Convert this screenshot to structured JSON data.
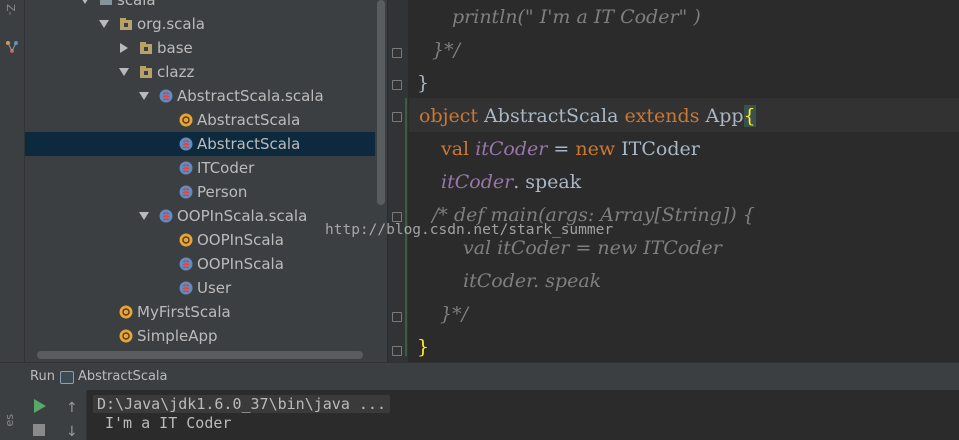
{
  "left_strip": {
    "label": "Z-"
  },
  "tree": {
    "rows": [
      {
        "label": "scala",
        "icon": "folder-icon",
        "expanded": true
      },
      {
        "label": "org.scala",
        "icon": "package-icon",
        "expanded": true
      },
      {
        "label": "base",
        "icon": "package-icon",
        "expanded": false
      },
      {
        "label": "clazz",
        "icon": "package-icon",
        "expanded": true
      },
      {
        "label": "AbstractScala.scala",
        "icon": "scala-file-icon",
        "expanded": true
      },
      {
        "label": "AbstractScala",
        "icon": "scala-trait-icon"
      },
      {
        "label": "AbstractScala",
        "icon": "scala-object-icon",
        "selected": true
      },
      {
        "label": "ITCoder",
        "icon": "scala-class-icon"
      },
      {
        "label": "Person",
        "icon": "scala-class-icon"
      },
      {
        "label": "OOPInScala.scala",
        "icon": "scala-file-icon",
        "expanded": true
      },
      {
        "label": "OOPInScala",
        "icon": "scala-trait-icon"
      },
      {
        "label": "OOPInScala",
        "icon": "scala-object-icon"
      },
      {
        "label": "User",
        "icon": "scala-class-icon"
      },
      {
        "label": "MyFirstScala",
        "icon": "scala-trait-icon"
      },
      {
        "label": "SimpleApp",
        "icon": "scala-trait-icon"
      }
    ]
  },
  "editor": {
    "lines": {
      "l1": "println(\" I'm a IT Coder\" )",
      "l2": "}*/",
      "l3": "}",
      "l4_kw1": "object",
      "l4_name": " AbstractScala ",
      "l4_kw2": "extends",
      "l4_app": " App",
      "l4_brace": "{",
      "l5_kw": "val",
      "l5_var": "itCoder",
      "l5_eq": " = ",
      "l5_new": "new",
      "l5_cls": " ITCoder",
      "l6_var": "itCoder",
      "l6_rest": ". speak",
      "l7": "/* def main(args: Array[String]) {",
      "l8": "val itCoder = new ITCoder",
      "l9": "itCoder. speak",
      "l10": "}*/",
      "l11": "}"
    },
    "watermark": "http://blog.csdn.net/stark_summer"
  },
  "run_panel": {
    "title": "Run",
    "config": "AbstractScala",
    "command": "D:\\Java\\jdk1.6.0_37\\bin\\java ...",
    "output": "I'm a IT Coder",
    "side_label": "es"
  },
  "colors": {
    "keyword": "#cc7832",
    "instance_var": "#9876aa",
    "comment": "#7f7f7f",
    "selection": "#0d293e",
    "run_green": "#59a869"
  }
}
